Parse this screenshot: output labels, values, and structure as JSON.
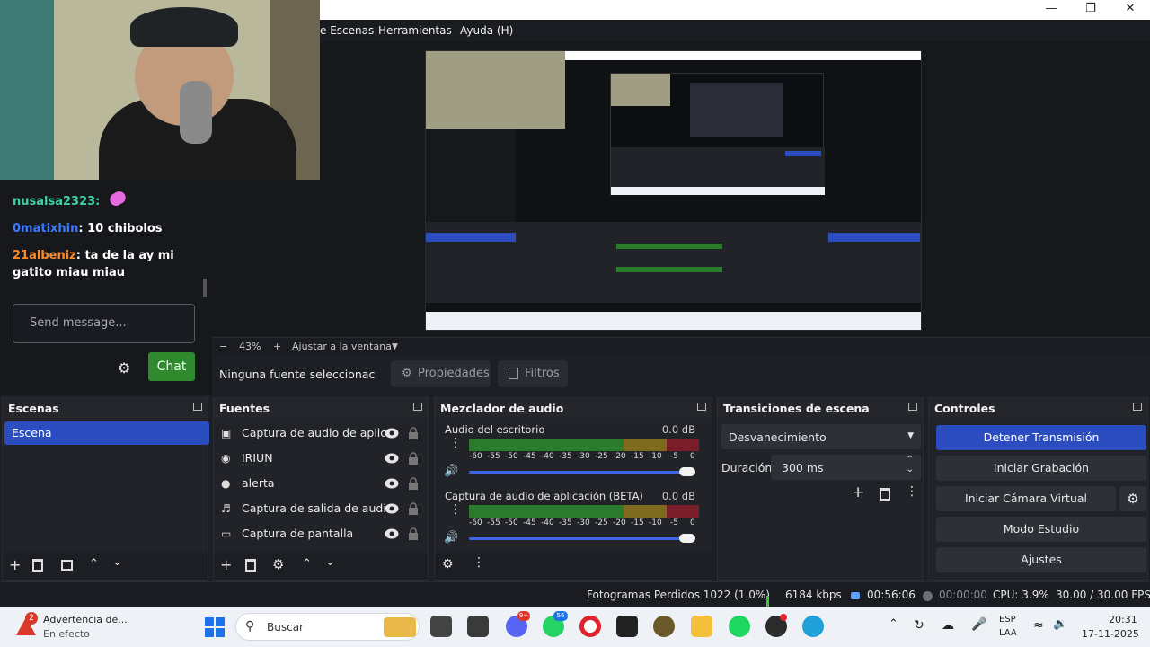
{
  "menu": {
    "items": [
      "e Escenas",
      "Herramientas",
      "Ayuda (H)"
    ]
  },
  "chat": {
    "messages": [
      {
        "user": "nusalsa2323",
        "sep": ":",
        "text": "",
        "color": "#3fd0a0"
      },
      {
        "user": "0matixhin",
        "sep": ":",
        "text": " 10 chibolos",
        "color": "#3a7bff"
      },
      {
        "user": "21albeniz",
        "sep": ":",
        "text": " ta de la ay mi gatito miau miau",
        "color": "#ff8a2a"
      }
    ],
    "placeholder": "Send message...",
    "chat_button": "Chat"
  },
  "preview": {
    "zoom": "43%",
    "fit_label": "Ajustar a la ventana"
  },
  "source_toolbar": {
    "no_source": "Ninguna fuente seleccionac",
    "properties": "Propiedades",
    "filters": "Filtros"
  },
  "docks": {
    "scenes": {
      "title": "Escenas",
      "items": [
        "Escena"
      ]
    },
    "sources": {
      "title": "Fuentes",
      "items": [
        "Captura de audio de aplicac",
        "IRIUN",
        "alerta",
        "Captura de salida de audio",
        "Captura de pantalla"
      ]
    },
    "mixer": {
      "title": "Mezclador de audio",
      "tracks": [
        {
          "name": "Audio del escritorio",
          "db": "0.0 dB"
        },
        {
          "name": "Captura de audio de aplicación (BETA)",
          "db": "0.0 dB"
        }
      ],
      "ticks": [
        "-60",
        "-55",
        "-50",
        "-45",
        "-40",
        "-35",
        "-30",
        "-25",
        "-20",
        "-15",
        "-10",
        "-5",
        "0"
      ]
    },
    "transitions": {
      "title": "Transiciones de escena",
      "selected": "Desvanecimiento",
      "duration_label": "Duración",
      "duration_value": "300 ms"
    },
    "controls": {
      "title": "Controles",
      "buttons": [
        "Detener Transmisión",
        "Iniciar Grabación",
        "Iniciar Cámara Virtual",
        "Modo Estudio",
        "Ajustes"
      ]
    }
  },
  "status": {
    "dropped": "Fotogramas Perdidos 1022 (1.0%)",
    "bitrate": "6184 kbps",
    "stream_time": "00:56:06",
    "rec_time": "00:00:00",
    "cpu": "CPU: 3.9%",
    "fps": "30.00 / 30.00 FPS"
  },
  "taskbar": {
    "notif_title": "Advertencia de...",
    "notif_sub": "En efecto",
    "notif_badge": "2",
    "search": "Buscar",
    "whatsapp_badge": "56",
    "discord_badge": "9+",
    "lang1": "ESP",
    "lang2": "LAA",
    "time": "20:31",
    "date": "17-11-2025"
  }
}
